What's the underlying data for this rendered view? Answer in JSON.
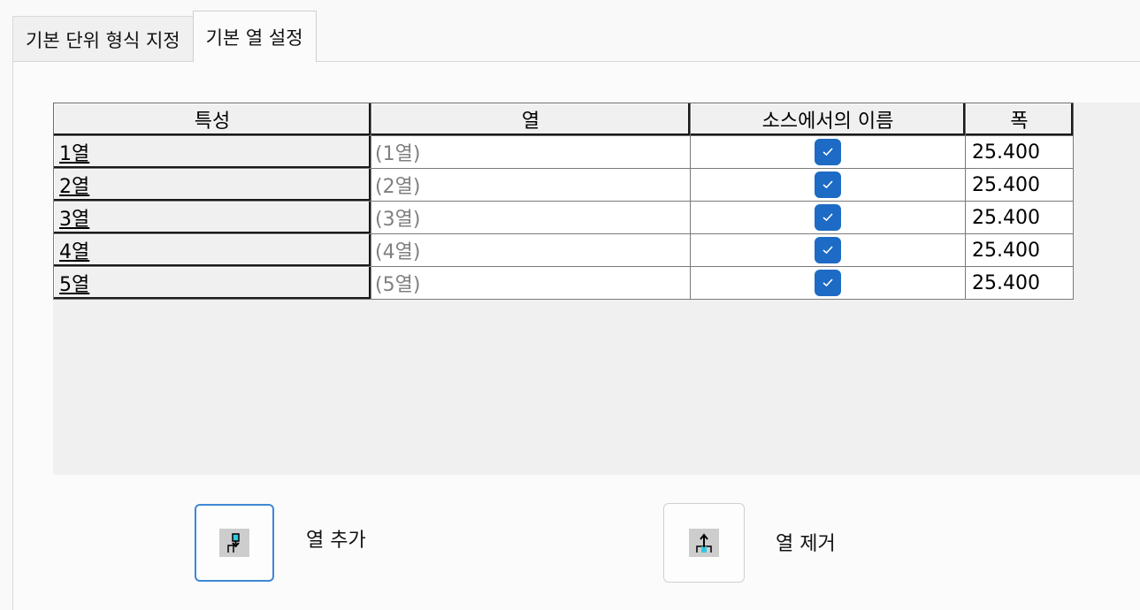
{
  "tabs": [
    {
      "label": "기본 단위 형식 지정",
      "active": false
    },
    {
      "label": "기본 열 설정",
      "active": true
    }
  ],
  "grid": {
    "headers": [
      "특성",
      "열",
      "소스에서의 이름",
      "폭"
    ],
    "rows": [
      {
        "property": "1열",
        "column": "(1열)",
        "source_name_checked": true,
        "width": "25.400"
      },
      {
        "property": "2열",
        "column": "(2열)",
        "source_name_checked": true,
        "width": "25.400"
      },
      {
        "property": "3열",
        "column": "(3열)",
        "source_name_checked": true,
        "width": "25.400"
      },
      {
        "property": "4열",
        "column": "(4열)",
        "source_name_checked": true,
        "width": "25.400"
      },
      {
        "property": "5열",
        "column": "(5열)",
        "source_name_checked": true,
        "width": "25.400"
      }
    ]
  },
  "buttons": {
    "add_column_label": "열 추가",
    "remove_column_label": "열 제거",
    "add_icon": "insert-column-icon",
    "remove_icon": "remove-column-icon"
  },
  "colors": {
    "checkbox_fill": "#1d6bc4",
    "focused_button_border": "#3e88d6"
  }
}
